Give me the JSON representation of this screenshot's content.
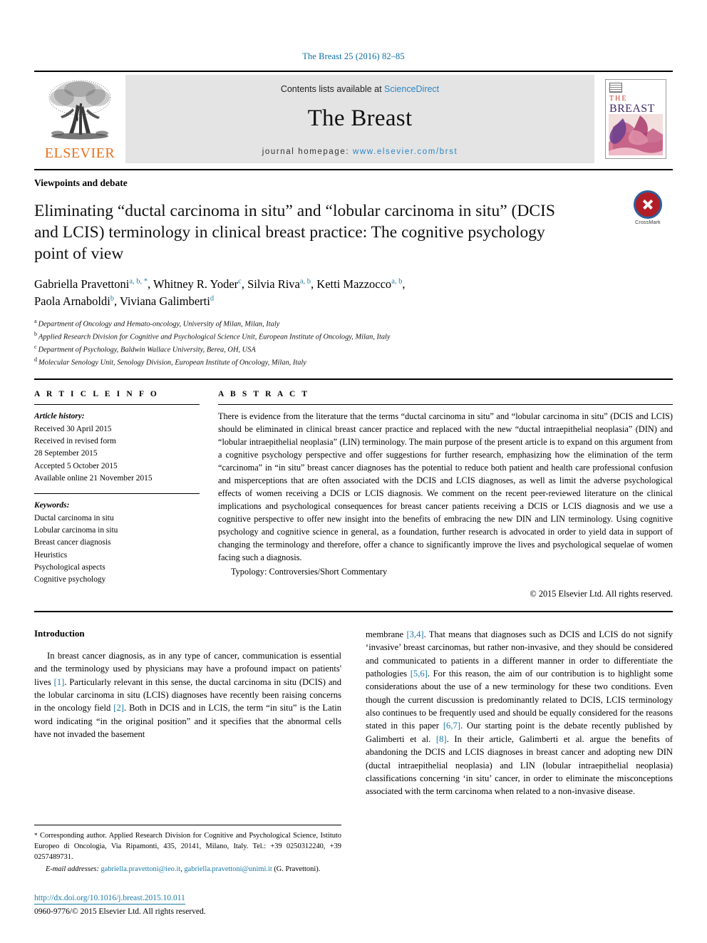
{
  "running_head": "The Breast 25 (2016) 82–85",
  "journal_header": {
    "publisher_name": "ELSEVIER",
    "contents_prefix": "Contents lists available at ",
    "contents_link": "ScienceDirect",
    "journal_title": "The Breast",
    "homepage_prefix": "journal homepage: ",
    "homepage_url": "www.elsevier.com/brst",
    "cover": {
      "the": "THE",
      "breast": "BREAST"
    },
    "link_color": "#2b85c4",
    "elsevier_orange": "#E9711C"
  },
  "article": {
    "kicker": "Viewpoints and debate",
    "title": "Eliminating “ductal carcinoma in situ” and “lobular carcinoma in situ” (DCIS and LCIS) terminology in clinical breast practice: The cognitive psychology point of view",
    "crossmark_label": "CrossMark",
    "authors_line1_a": "Gabriella Pravettoni",
    "authors_line1_a_sup": "a, b, *",
    "authors_line1_b": ", Whitney R. Yoder",
    "authors_line1_b_sup": "c",
    "authors_line1_c": ", Silvia Riva",
    "authors_line1_c_sup": "a, b",
    "authors_line1_d": ", Ketti Mazzocco",
    "authors_line1_d_sup": "a, b",
    "authors_line1_tail": ",",
    "authors_line2_a": "Paola Arnaboldi",
    "authors_line2_a_sup": "b",
    "authors_line2_b": ", Viviana Galimberti",
    "authors_line2_b_sup": "d",
    "affiliations": [
      {
        "mark": "a",
        "text": "Department of Oncology and Hemato-oncology, University of Milan, Milan, Italy"
      },
      {
        "mark": "b",
        "text": "Applied Research Division for Cognitive and Psychological Science Unit, European Institute of Oncology, Milan, Italy"
      },
      {
        "mark": "c",
        "text": "Department of Psychology, Baldwin Wallace University, Berea, OH, USA"
      },
      {
        "mark": "d",
        "text": "Molecular Senology Unit, Senology Division, European Institute of Oncology, Milan, Italy"
      }
    ]
  },
  "article_info": {
    "heading": "A R T I C L E  I N F O",
    "history_label": "Article history:",
    "history": [
      "Received 30 April 2015",
      "Received in revised form",
      "28 September 2015",
      "Accepted 5 October 2015",
      "Available online 21 November 2015"
    ],
    "keywords_label": "Keywords:",
    "keywords": [
      "Ductal carcinoma in situ",
      "Lobular carcinoma in situ",
      "Breast cancer diagnosis",
      "Heuristics",
      "Psychological aspects",
      "Cognitive psychology"
    ]
  },
  "abstract": {
    "heading": "A B S T R A C T",
    "text": "There is evidence from the literature that the terms “ductal carcinoma in situ” and “lobular carcinoma in situ” (DCIS and LCIS) should be eliminated in clinical breast cancer practice and replaced with the new “ductal intraepithelial neoplasia” (DIN) and “lobular intraepithelial neoplasia” (LIN) terminology. The main purpose of the present article is to expand on this argument from a cognitive psychology perspective and offer suggestions for further research, emphasizing how the elimination of the term “carcinoma” in “in situ” breast cancer diagnoses has the potential to reduce both patient and health care professional confusion and misperceptions that are often associated with the DCIS and LCIS diagnoses, as well as limit the adverse psychological effects of women receiving a DCIS or LCIS diagnosis. We comment on the recent peer-reviewed literature on the clinical implications and psychological consequences for breast cancer patients receiving a DCIS or LCIS diagnosis and we use a cognitive perspective to offer new insight into the benefits of embracing the new DIN and LIN terminology. Using cognitive psychology and cognitive science in general, as a foundation, further research is advocated in order to yield data in support of changing the terminology and therefore, offer a chance to significantly improve the lives and psychological sequelae of women facing such a diagnosis.",
    "typology": "Typology: Controversies/Short Commentary",
    "rights": "© 2015 Elsevier Ltd. All rights reserved."
  },
  "body": {
    "heading": "Introduction",
    "left_para_1": "In breast cancer diagnosis, as in any type of cancer, communication is essential and the terminology used by physicians may have a profound impact on patients' lives ",
    "left_cite_1": "[1]",
    "left_para_2": ". Particularly relevant in this sense, the ductal carcinoma in situ (DCIS) and the lobular carcinoma in situ (LCIS) diagnoses have recently been raising concerns in the oncology field ",
    "left_cite_2": "[2]",
    "left_para_3": ". Both in DCIS and in LCIS, the term “in situ” is the Latin word indicating “in the original position” and it specifies that the abnormal cells have not invaded the basement",
    "right_para_1": "membrane ",
    "right_cite_1": "[3,4]",
    "right_para_2": ". That means that diagnoses such as DCIS and LCIS do not signify ‘invasive’ breast carcinomas, but rather non-invasive, and they should be considered and communicated to patients in a different manner in order to differentiate the pathologies ",
    "right_cite_2": "[5,6]",
    "right_para_3": ". For this reason, the aim of our contribution is to highlight some considerations about the use of a new terminology for these two conditions. Even though the current discussion is predominantly related to DCIS, LCIS terminology also continues to be frequently used and should be equally considered for the reasons stated in this paper ",
    "right_cite_3": "[6,7]",
    "right_para_4": ". Our starting point is the debate recently published by Galimberti et al. ",
    "right_cite_4": "[8]",
    "right_para_5": ". In their article, Galimberti et al. argue the benefits of abandoning the DCIS and LCIS diagnoses in breast cancer and adopting new DIN (ductal intraepithelial neoplasia) and LIN (lobular intraepithelial neoplasia) classifications concerning ‘in situ’ cancer, in order to eliminate the misconceptions associated with the term carcinoma when related to a non-invasive disease."
  },
  "footnote": {
    "marker": "*",
    "text": " Corresponding author. Applied Research Division for Cognitive and Psychological Science, Istituto Europeo di Oncologia, Via Ripamonti, 435, 20141, Milano, Italy. Tel.: +39 0250312240, +39 0257489731.",
    "email_label": "E-mail addresses:",
    "email_1": "gabriella.pravettoni@ieo.it",
    "email_sep": ", ",
    "email_2": "gabriella.pravettoni@unimi.it",
    "email_tail": "(G. Pravettoni)."
  },
  "page_footer": {
    "doi": "http://dx.doi.org/10.1016/j.breast.2015.10.011",
    "issn": "0960-9776/© 2015 Elsevier Ltd. All rights reserved."
  }
}
